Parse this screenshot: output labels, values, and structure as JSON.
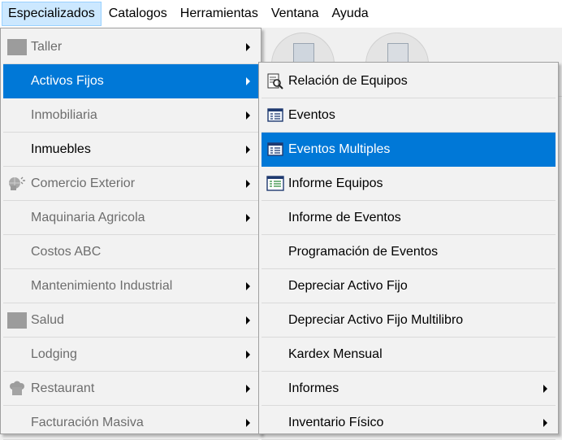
{
  "menubar": {
    "items": [
      "Especializados",
      "Catalogos",
      "Herramientas",
      "Ventana",
      "Ayuda"
    ]
  },
  "menu_especializados": {
    "items": [
      {
        "label": "Taller",
        "icon": "gray-square-icon",
        "submenu": true,
        "state": "disabled"
      },
      {
        "label": "Activos Fijos",
        "icon": "",
        "submenu": true,
        "state": "selected"
      },
      {
        "label": "Inmobiliaria",
        "icon": "",
        "submenu": true,
        "state": "disabled"
      },
      {
        "label": "Inmuebles",
        "icon": "",
        "submenu": true,
        "state": "enabled"
      },
      {
        "label": "Comercio Exterior",
        "icon": "globe-house-icon",
        "submenu": true,
        "state": "disabled"
      },
      {
        "label": "Maquinaria Agricola",
        "icon": "",
        "submenu": true,
        "state": "disabled"
      },
      {
        "label": "Costos ABC",
        "icon": "",
        "submenu": false,
        "state": "disabled"
      },
      {
        "label": "Mantenimiento Industrial",
        "icon": "",
        "submenu": true,
        "state": "disabled"
      },
      {
        "label": "Salud",
        "icon": "gray-square-icon",
        "submenu": true,
        "state": "disabled"
      },
      {
        "label": "Lodging",
        "icon": "",
        "submenu": true,
        "state": "disabled"
      },
      {
        "label": "Restaurant",
        "icon": "gray-chef-icon",
        "submenu": true,
        "state": "disabled"
      },
      {
        "label": "Facturación Masiva",
        "icon": "",
        "submenu": true,
        "state": "disabled"
      }
    ]
  },
  "menu_activos_fijos": {
    "items": [
      {
        "label": "Relación de Equipos",
        "icon": "document-search-icon",
        "submenu": false,
        "state": "enabled"
      },
      {
        "label": "Eventos",
        "icon": "table-icon",
        "submenu": false,
        "state": "enabled"
      },
      {
        "label": "Eventos Multiples",
        "icon": "table-icon",
        "submenu": false,
        "state": "selected"
      },
      {
        "label": "Informe Equipos",
        "icon": "report-table-icon",
        "submenu": false,
        "state": "enabled"
      },
      {
        "label": "Informe de Eventos",
        "icon": "",
        "submenu": false,
        "state": "enabled"
      },
      {
        "label": "Programación de Eventos",
        "icon": "",
        "submenu": false,
        "state": "enabled"
      },
      {
        "label": "Depreciar Activo Fijo",
        "icon": "",
        "submenu": false,
        "state": "enabled"
      },
      {
        "label": "Depreciar Activo Fijo Multilibro",
        "icon": "",
        "submenu": false,
        "state": "enabled"
      },
      {
        "label": "Kardex Mensual",
        "icon": "",
        "submenu": false,
        "state": "enabled"
      },
      {
        "label": "Informes",
        "icon": "",
        "submenu": true,
        "state": "enabled"
      },
      {
        "label": "Inventario Físico",
        "icon": "",
        "submenu": true,
        "state": "enabled"
      }
    ]
  },
  "colors": {
    "selected": "#0078d7",
    "menubar_open": "#cce8ff",
    "disabled_text": "#6d6d6d"
  }
}
